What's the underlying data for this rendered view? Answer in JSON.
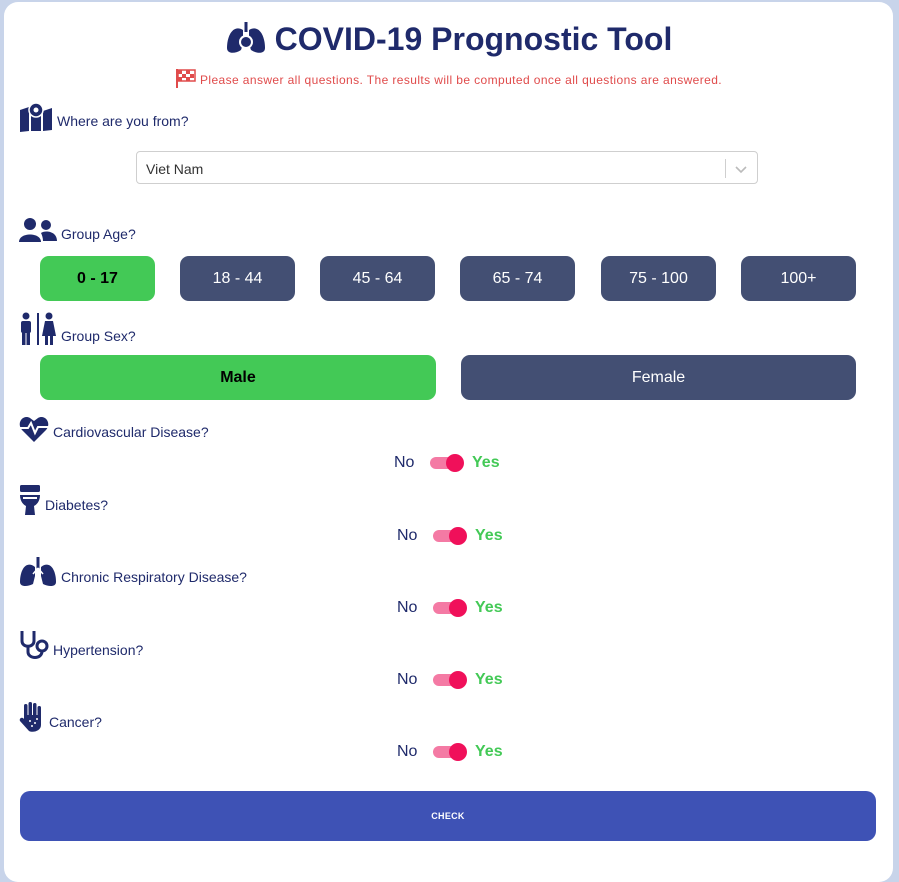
{
  "app": {
    "title": "COVID-19 Prognostic Tool",
    "notice": "Please answer all questions. The results will be computed once all questions are answered."
  },
  "location": {
    "label": "Where are you from?",
    "selected": "Viet Nam"
  },
  "age": {
    "label": "Group Age?",
    "options": [
      "0 - 17",
      "18 - 44",
      "45 - 64",
      "65 - 74",
      "75 - 100",
      "100+"
    ],
    "selected_index": 0
  },
  "sex": {
    "label": "Group Sex?",
    "options": [
      "Male",
      "Female"
    ],
    "selected_index": 0
  },
  "conditions": [
    {
      "label": "Cardiovascular Disease?",
      "no": "No",
      "yes": "Yes",
      "value": "Yes",
      "icon": "heart-pulse-icon"
    },
    {
      "label": "Diabetes?",
      "no": "No",
      "yes": "Yes",
      "value": "Yes",
      "icon": "toilet-icon"
    },
    {
      "label": "Chronic Respiratory Disease?",
      "no": "No",
      "yes": "Yes",
      "value": "Yes",
      "icon": "lungs-icon"
    },
    {
      "label": "Hypertension?",
      "no": "No",
      "yes": "Yes",
      "value": "Yes",
      "icon": "stethoscope-icon"
    },
    {
      "label": "Cancer?",
      "no": "No",
      "yes": "Yes",
      "value": "Yes",
      "icon": "hand-icon"
    }
  ],
  "actions": {
    "check_label": "CHECK"
  },
  "colors": {
    "primary_text": "#1f2a6b",
    "selected": "#43c956",
    "unselected": "#434f73",
    "toggle": "#f0105a",
    "check_button": "#3e52b5",
    "notice": "#e04b4b"
  }
}
